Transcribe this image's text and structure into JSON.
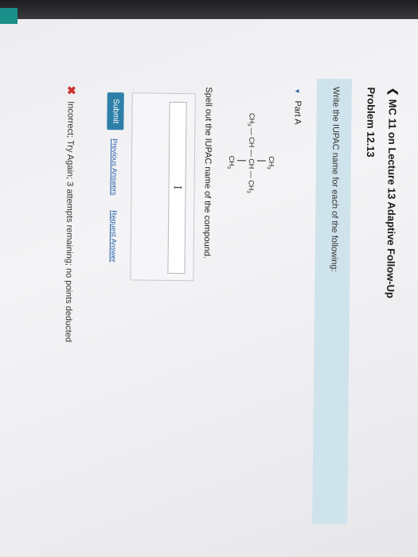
{
  "header": {
    "back_label": "MC 11 on Lecture 13 Adaptive Follow-Up",
    "problem_title": "Problem 12.13"
  },
  "instructions": "Write the IUPAC name for each of the following:",
  "part": {
    "label": "Part A",
    "structure": {
      "top": "CH3",
      "main_chain": "CH3 — CH — CH — CH3",
      "bottom": "CH3"
    },
    "prompt": "Spell out the IUPAC name of the compound.",
    "answer_value": ""
  },
  "actions": {
    "submit_label": "Submit",
    "previous_label": "Previous Answers",
    "request_label": "Request Answer"
  },
  "feedback": {
    "text": "Incorrect; Try Again; 3 attempts remaining; no points deducted",
    "status_color": "#cc2f2f"
  },
  "colors": {
    "instructions_bg": "#cfe3ec",
    "submit_bg": "#2d7fa8",
    "link": "#2560a8"
  }
}
